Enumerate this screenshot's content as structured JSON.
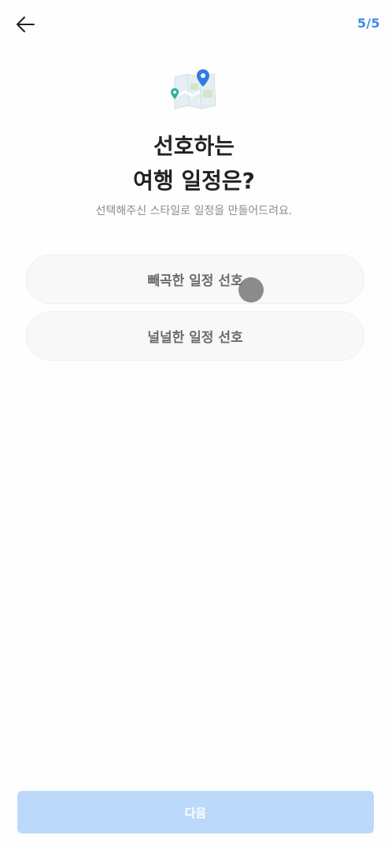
{
  "header": {
    "back_icon": "arrow-left-icon",
    "step": "5/5"
  },
  "hero": {
    "icon": "map-pin-icon"
  },
  "question": {
    "title_line1": "선호하는",
    "title_line2": "여행 일정은?",
    "subtitle": "선택해주신 스타일로 일정을 만들어드려요."
  },
  "options": [
    {
      "label": "빼곡한 일정 선호"
    },
    {
      "label": "널널한 일정 선호"
    }
  ],
  "footer": {
    "next_label": "다음"
  },
  "colors": {
    "accent": "#3d8ae6",
    "next_disabled": "#bcd8fb",
    "option_bg": "#f8f8f8",
    "title": "#222222",
    "subtitle": "#8c8c8c"
  }
}
